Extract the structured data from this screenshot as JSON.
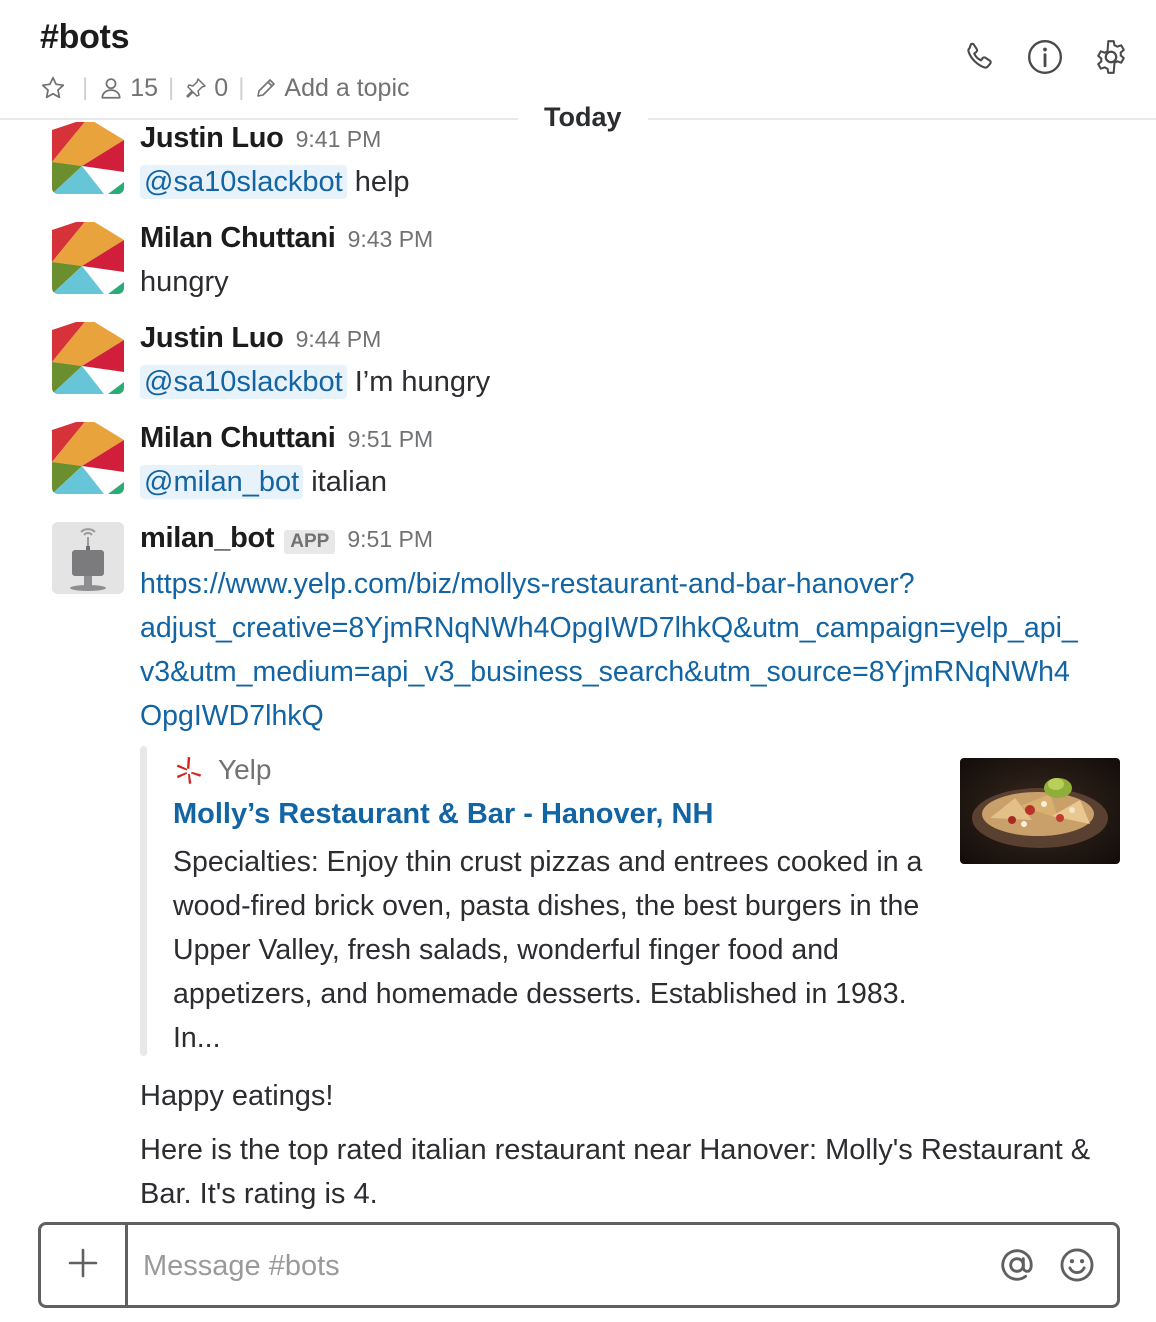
{
  "header": {
    "channel_title": "#bots",
    "member_count": "15",
    "pinned_count": "0",
    "topic_placeholder": "Add a topic"
  },
  "day_divider": "Today",
  "messages": [
    {
      "author": "Justin Luo",
      "time": "9:41 PM",
      "mention": "@sa10slackbot",
      "text": "help"
    },
    {
      "author": "Milan Chuttani",
      "time": "9:43 PM",
      "text": "hungry"
    },
    {
      "author": "Justin Luo",
      "time": "9:44 PM",
      "mention": "@sa10slackbot",
      "text": "I’m hungry"
    },
    {
      "author": "Milan Chuttani",
      "time": "9:51 PM",
      "mention": "@milan_bot",
      "text": "italian"
    }
  ],
  "bot_message": {
    "author": "milan_bot",
    "badge": "APP",
    "time": "9:51 PM",
    "link_lines": [
      "https://www.yelp.com/biz/mollys-restaurant-and-bar-hanover?",
      "adjust_creative=8YjmRNqNWh4OpgIWD7lhkQ&utm_campaign=yelp_api_",
      "v3&utm_medium=api_v3_business_search&utm_source=8YjmRNqNWh4",
      "OpgIWD7lhkQ"
    ],
    "attachment": {
      "service_name": "Yelp",
      "title": "Molly’s Restaurant & Bar - Hanover, NH",
      "description": "Specialties: Enjoy thin crust pizzas and entrees cooked in a wood-fired brick oven, pasta dishes, the best burgers in the Upper Valley, fresh salads, wonderful finger food and appetizers, and homemade desserts. Established in 1983. In..."
    },
    "followup_1": "Happy eatings!",
    "followup_2": "Here is the top rated italian restaurant near Hanover: Molly's Restaurant & Bar. It's rating is 4."
  },
  "composer": {
    "placeholder": "Message #bots"
  },
  "icons": {
    "star": "star-icon",
    "members": "person-icon",
    "pins": "pin-icon",
    "topic": "pencil-icon",
    "call": "phone-icon",
    "info": "info-icon",
    "settings": "gear-icon",
    "add": "plus-icon",
    "mention": "at-sign-icon",
    "emoji": "smiley-icon",
    "yelp": "yelp-burst-icon"
  },
  "colors": {
    "link": "#1264a3",
    "mention_bg": "#e8f2fa",
    "text": "#2c2d30",
    "muted": "#717274"
  }
}
